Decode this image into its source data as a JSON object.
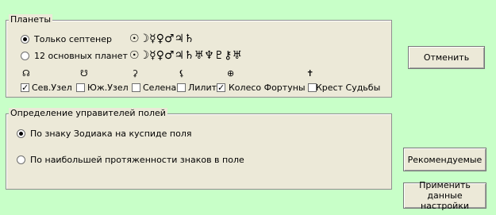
{
  "planets_group": {
    "title": "Планеты",
    "options": [
      {
        "label": "Только септенер",
        "checked": true,
        "glyphs": "☉☽☿♀♂♃♄"
      },
      {
        "label": "12 основных планет",
        "checked": false,
        "glyphs": "☉☽☿♀♂♃♄♅♆♇⚷♅"
      }
    ],
    "points": [
      {
        "symbol": "☊",
        "label": "Сев.Узел",
        "checked": true
      },
      {
        "symbol": "☋",
        "label": "Юж.Узел",
        "checked": false
      },
      {
        "symbol": "⚳",
        "label": "Селена",
        "checked": false
      },
      {
        "symbol": "⚸",
        "label": "Лилит",
        "checked": true
      },
      {
        "symbol": "⊕",
        "label": "Колесо Фортуны",
        "checked": false
      },
      {
        "symbol": "✝",
        "label": "Крест Судьбы",
        "checked": false
      }
    ]
  },
  "rulers_group": {
    "title": "Определение управителей полей",
    "options": [
      {
        "label": "По знаку Зодиака на куспиде поля",
        "checked": true
      },
      {
        "label": "По наибольшей протяженности знаков в поле",
        "checked": false
      }
    ]
  },
  "buttons": {
    "cancel": "Отменить",
    "recommended": "Рекомендуемые",
    "apply": "Применить данные настройки"
  },
  "check_mark": "✓"
}
